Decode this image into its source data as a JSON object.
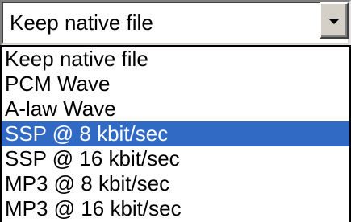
{
  "combo": {
    "value": "Keep native file",
    "arrow_icon": "chevron-down-icon"
  },
  "colors": {
    "highlight": "#316ac5",
    "highlight_text": "#ffffff"
  },
  "options": [
    {
      "label": "Keep native file",
      "selected": false
    },
    {
      "label": "PCM Wave",
      "selected": false
    },
    {
      "label": "A-law Wave",
      "selected": false
    },
    {
      "label": "SSP @ 8 kbit/sec",
      "selected": true
    },
    {
      "label": "SSP @ 16 kbit/sec",
      "selected": false
    },
    {
      "label": "MP3 @ 8 kbit/sec",
      "selected": false
    },
    {
      "label": "MP3 @ 16 kbit/sec",
      "selected": false
    }
  ]
}
